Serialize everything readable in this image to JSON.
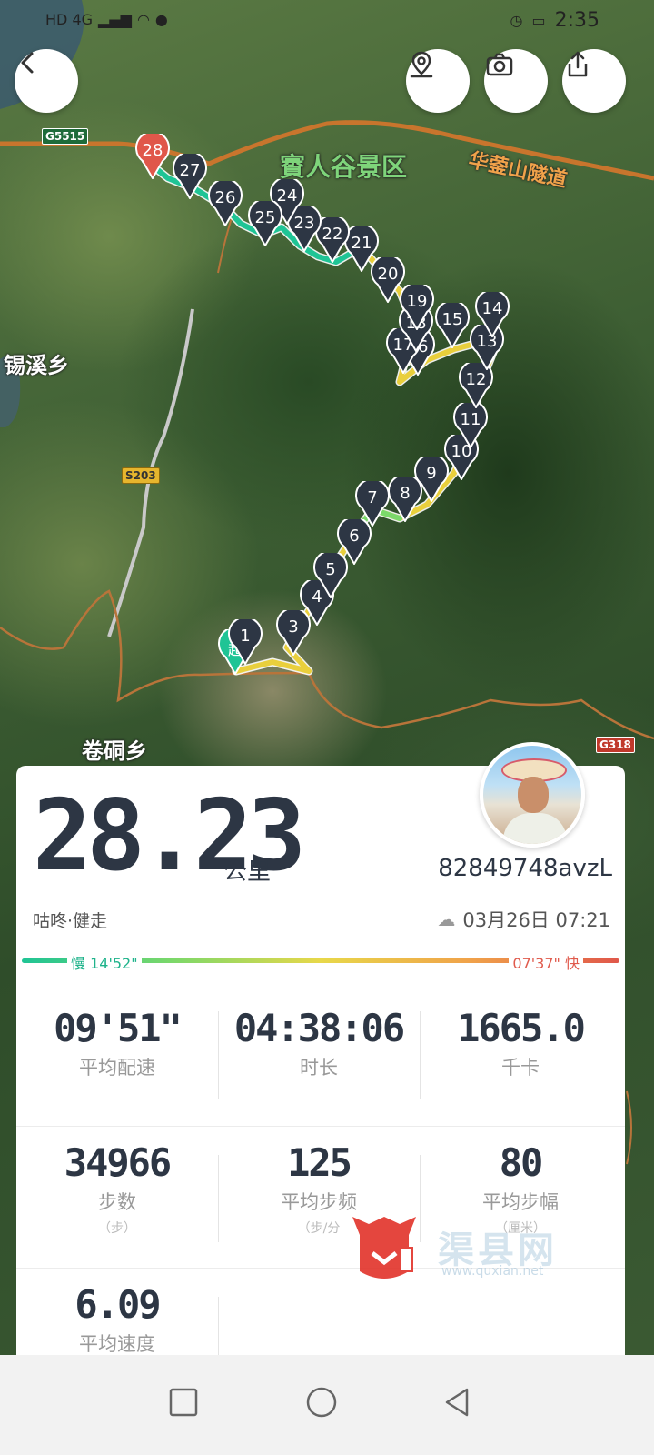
{
  "status_bar": {
    "network": "HD 4G",
    "time": "2:35"
  },
  "map": {
    "places": {
      "scenic_area": "賨人谷景区",
      "tunnel": "华蓥山隧道",
      "township_west": "锡溪乡",
      "township_south": "卷硐乡"
    },
    "road_shields": {
      "expressway": "G5515",
      "provincial": "S203",
      "national": "G318"
    },
    "markers": [
      "1",
      "3",
      "4",
      "5",
      "6",
      "7",
      "8",
      "9",
      "10",
      "11",
      "12",
      "13",
      "14",
      "15",
      "16",
      "17",
      "18",
      "19",
      "20",
      "21",
      "22",
      "23",
      "24",
      "25",
      "26",
      "27",
      "28"
    ],
    "start_label": "起",
    "icons": [
      "back-icon",
      "location-icon",
      "camera-icon",
      "share-icon"
    ]
  },
  "summary": {
    "distance": "28.23",
    "distance_unit": "公里",
    "username": "82849748avzL",
    "activity_type": "咕咚·健走",
    "datetime": "03月26日 07:21"
  },
  "pace_legend": {
    "slow_label": "慢 14'52\"",
    "fast_label": "07'37\" 快",
    "colors": [
      "#1fc495",
      "#7bd86a",
      "#e8d84a",
      "#f0a24a",
      "#e0574a"
    ]
  },
  "stats": [
    {
      "value": "09'51\"",
      "label": "平均配速",
      "unit": ""
    },
    {
      "value": "04:38:06",
      "label": "时长",
      "unit": ""
    },
    {
      "value": "1665.0",
      "label": "千卡",
      "unit": ""
    },
    {
      "value": "34966",
      "label": "步数",
      "unit": "（步）"
    },
    {
      "value": "125",
      "label": "平均步频",
      "unit": "（步/分"
    },
    {
      "value": "80",
      "label": "平均步幅",
      "unit": "（厘米）"
    },
    {
      "value": "6.09",
      "label": "平均速度",
      "unit": ""
    }
  ],
  "watermark": {
    "text": "渠县网",
    "sub": "www.quxian.net"
  },
  "navbar": {
    "icons": [
      "recent-apps-icon",
      "home-icon",
      "back-nav-icon"
    ]
  }
}
